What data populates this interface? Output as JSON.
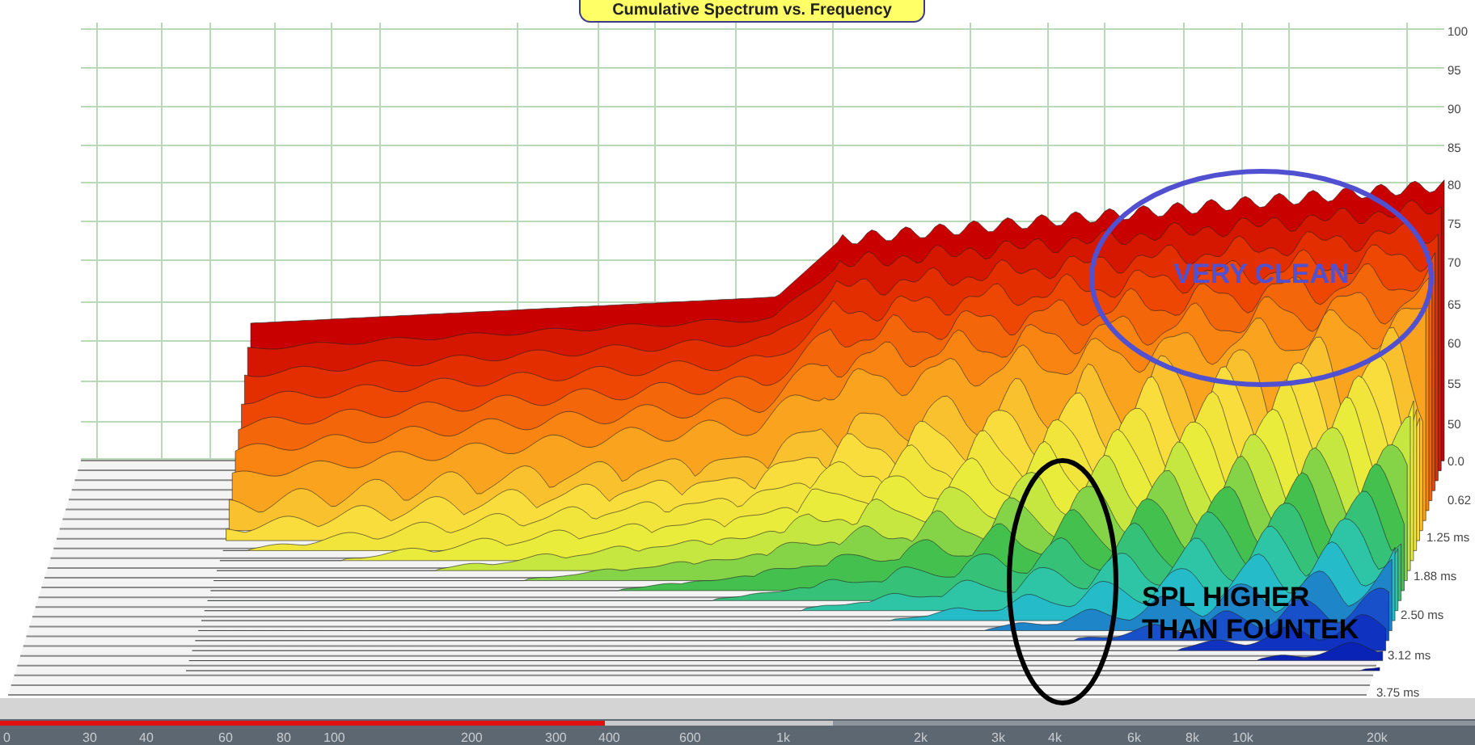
{
  "window": {
    "title": "Cumulative Spectrum vs. Frequency"
  },
  "chart": {
    "y_labels": [
      "100",
      "95",
      "90",
      "85",
      "80",
      "75",
      "70",
      "65",
      "60",
      "55",
      "50",
      "0.0",
      "0.62"
    ],
    "time_labels": [
      "1.25 ms",
      "1.88 ms",
      "2.50 ms",
      "3.12 ms",
      "3.75 ms"
    ],
    "x_labels": [
      "0",
      "30",
      "40",
      "60",
      "80",
      "100",
      "200",
      "300",
      "400",
      "600",
      "1k",
      "2k",
      "3k",
      "4k",
      "6k",
      "8k",
      "10k",
      "20k"
    ],
    "annotations": [
      {
        "kind": "ellipse",
        "text": "VERY CLEAN",
        "color": "#5050d0"
      },
      {
        "kind": "ellipse",
        "text": "SPL HIGHER THAN FOUNTEK",
        "color": "#000000"
      }
    ]
  },
  "player": {
    "buffered": {
      "level": 0.565
    },
    "played": {
      "level": 0.41
    }
  }
}
